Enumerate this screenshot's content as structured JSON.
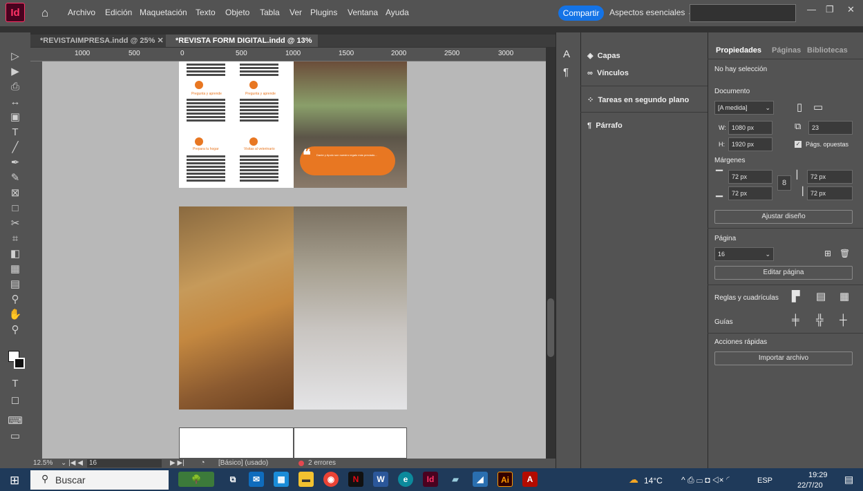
{
  "app": {
    "icon_label": "Id"
  },
  "menu": [
    "Archivo",
    "Edición",
    "Maquetación",
    "Texto",
    "Objeto",
    "Tabla",
    "Ver",
    "Plugins",
    "Ventana",
    "Ayuda"
  ],
  "header": {
    "share": "Compartir",
    "workspace": "Aspectos esenciales"
  },
  "tabs": [
    {
      "label": "*REVISTAIMPRESA.indd @ 25%",
      "active": false
    },
    {
      "label": "*REVISTA FORM DIGITAL.indd @ 13%",
      "active": true
    }
  ],
  "ruler": [
    "1000",
    "500",
    "0",
    "500",
    "1000",
    "1500",
    "2000",
    "2500",
    "3000"
  ],
  "page1": {
    "captions": [
      "Pregunta y aprende",
      "Pregunta y aprende",
      "Prepara tu hogar",
      "Visitas al veterinario"
    ],
    "quote": "Dante y Apolo son nuestro regalo más preciado..."
  },
  "status": {
    "zoom": "12.5%",
    "page": "16",
    "style": "[Básico] (usado)",
    "errors": "2 errores"
  },
  "panels": {
    "layers": "Capas",
    "links": "Vínculos",
    "background_tasks": "Tareas en segundo plano",
    "paragraph": "Párrafo"
  },
  "properties": {
    "tabs": [
      "Propiedades",
      "Páginas",
      "Bibliotecas"
    ],
    "no_selection": "No hay selección",
    "document_label": "Documento",
    "preset": "[A medida]",
    "width_label": "W:",
    "width": "1080 px",
    "height_label": "H:",
    "height": "1920 px",
    "pages": "23",
    "facing_pages": "Págs. opuestas",
    "margins_label": "Márgenes",
    "margin_top": "72 px",
    "margin_bottom": "72 px",
    "margin_left": "72 px",
    "margin_right": "72 px",
    "adjust_layout": "Ajustar diseño",
    "page_label": "Página",
    "page": "16",
    "edit_page": "Editar página",
    "rulers_grids": "Reglas y cuadrículas",
    "guides": "Guías",
    "quick_actions": "Acciones rápidas",
    "import_file": "Importar archivo"
  },
  "taskbar": {
    "search": "Buscar",
    "weather": "14°C",
    "lang": "ESP",
    "time": "19:29",
    "date": "22/7/20"
  }
}
